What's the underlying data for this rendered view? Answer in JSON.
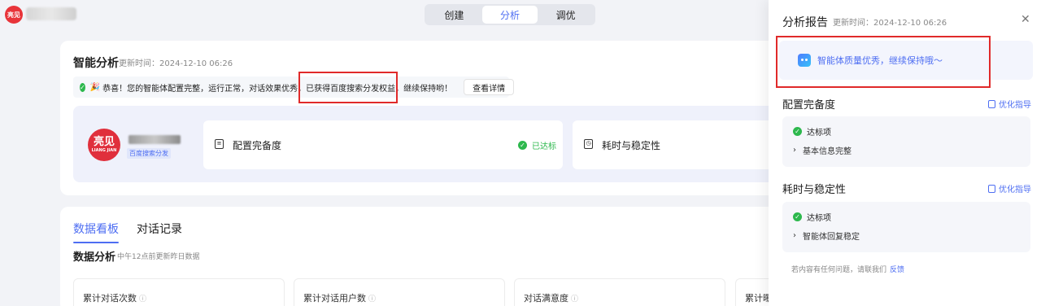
{
  "topbar": {
    "logo_text": "亮见",
    "tabs": [
      {
        "label": "创建",
        "active": false
      },
      {
        "label": "分析",
        "active": true
      },
      {
        "label": "调优",
        "active": false
      }
    ]
  },
  "analysis": {
    "title": "智能分析",
    "update_time": "更新时间：2024-12-10 06:26",
    "notice_party": "🎉",
    "notice_text": "恭喜！您的智能体配置完整，运行正常，对话效果优秀，已获得百度搜索分发权益，继续保持哟！",
    "detail_button": "查看详情",
    "agent": {
      "avatar_big": "亮见",
      "avatar_small": "LIANG JIAN",
      "tag": "百度搜索分发"
    },
    "config_card": {
      "label": "配置完备度",
      "status": "已达标"
    },
    "latency_card": {
      "label": "耗时与稳定性"
    }
  },
  "data_panel": {
    "tabs": [
      {
        "label": "数据看板",
        "active": true
      },
      {
        "label": "对话记录",
        "active": false
      }
    ],
    "section_title": "数据分析",
    "section_note": "中午12点前更新昨日数据",
    "metrics": [
      "累计对话次数",
      "累计对话用户数",
      "对话满意度",
      "累计曝"
    ]
  },
  "drawer": {
    "title": "分析报告",
    "update_time": "更新时间：2024-12-10 06:26",
    "close": "✕",
    "quality_text": "智能体质量优秀，继续保持哦～",
    "sections": [
      {
        "title": "配置完备度",
        "guide": "优化指导",
        "status": "达标项",
        "item": "基本信息完整"
      },
      {
        "title": "耗时与稳定性",
        "guide": "优化指导",
        "status": "达标项",
        "item": "智能体回复稳定"
      }
    ],
    "footer_text": "若内容有任何问题，请联我们",
    "footer_link": "反馈"
  },
  "colors": {
    "accent": "#4e6ef2",
    "success": "#2db84d",
    "highlight_box": "#e02a2a",
    "brand_red": "#e8343a"
  },
  "icons": [
    "logo-icon",
    "check-circle-icon",
    "party-popper-icon",
    "document-icon",
    "timer-icon",
    "bot-icon",
    "close-icon",
    "chevron-right-icon",
    "info-icon"
  ]
}
